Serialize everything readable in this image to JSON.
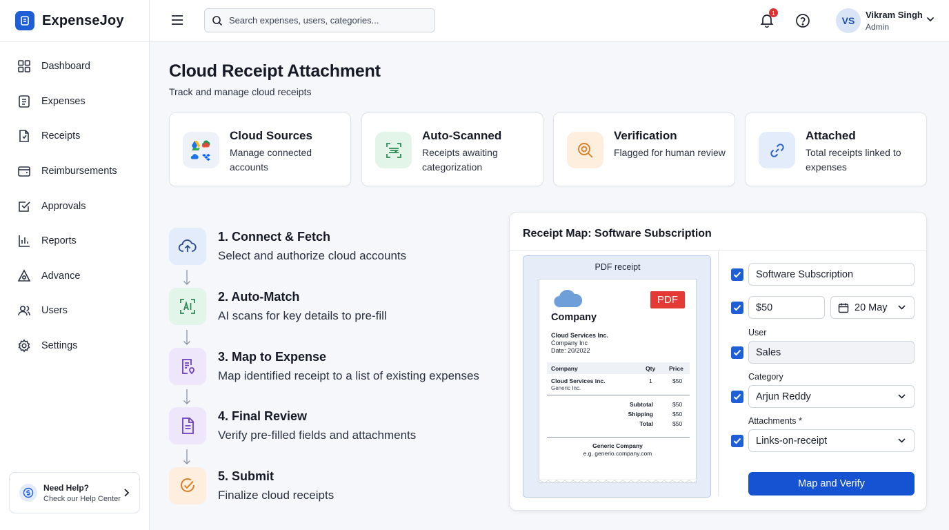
{
  "app": {
    "name": "ExpenseJoy"
  },
  "sidebar": {
    "items": [
      {
        "label": "Dashboard",
        "icon": "grid-icon"
      },
      {
        "label": "Expenses",
        "icon": "list-icon"
      },
      {
        "label": "Receipts",
        "icon": "receipt-icon"
      },
      {
        "label": "Reimbursements",
        "icon": "wallet-icon"
      },
      {
        "label": "Approvals",
        "icon": "check-square-icon"
      },
      {
        "label": "Reports",
        "icon": "bar-chart-icon"
      },
      {
        "label": "Advance",
        "icon": "triangle-icon"
      },
      {
        "label": "Users",
        "icon": "users-icon"
      },
      {
        "label": "Settings",
        "icon": "gear-icon"
      }
    ],
    "help": {
      "title": "Need Help?",
      "subtitle": "Check our Help Center"
    }
  },
  "topbar": {
    "search_placeholder": "Search expenses, users, categories...",
    "notifications_count": "1",
    "user": {
      "initials": "VS",
      "name": "Vikram Singh",
      "role": "Admin"
    }
  },
  "page": {
    "title": "Cloud Receipt Attachment",
    "subtitle": "Track and manage cloud receipts"
  },
  "cards": [
    {
      "title": "Cloud Sources",
      "desc": "Manage connected accounts",
      "icon": "cloud-apps-icon",
      "bg": "#eef2f8"
    },
    {
      "title": "Auto-Scanned",
      "desc": "Receipts awaiting categorization",
      "icon": "scan-icon",
      "bg": "#e3f4e8"
    },
    {
      "title": "Verification",
      "desc": "Flagged for human review",
      "icon": "magnify-icon",
      "bg": "#fdeedd"
    },
    {
      "title": "Attached",
      "desc": "Total receipts linked to expenses",
      "icon": "link-icon",
      "bg": "#e3ecfb"
    }
  ],
  "steps": [
    {
      "title": "1. Connect & Fetch",
      "desc": "Select and authorize cloud accounts",
      "icon": "cloud-upload-icon",
      "bg": "#e3ecfb"
    },
    {
      "title": "2. Auto-Match",
      "desc": "AI scans for key details to pre-fill",
      "icon": "ai-icon",
      "bg": "#e3f4e8"
    },
    {
      "title": "3. Map to Expense",
      "desc": "Map identified receipt to a list of existing expenses",
      "icon": "map-doc-icon",
      "bg": "#eee6fa"
    },
    {
      "title": "4. Final Review",
      "desc": "Verify pre-filled fields and attachments",
      "icon": "document-icon",
      "bg": "#eee6fa"
    },
    {
      "title": "5. Submit",
      "desc": "Finalize cloud receipts",
      "icon": "check-circle-icon",
      "bg": "#fdeedd"
    }
  ],
  "map_panel": {
    "title": "Receipt Map: Software Subscription",
    "receipt": {
      "label": "PDF receipt",
      "badge": "PDF",
      "company": "Company",
      "vendor": "Cloud Services Inc.",
      "vendor_sub": "Company Inc",
      "date": "Date: 20/2022",
      "columns": [
        "Company",
        "Qty",
        "Price"
      ],
      "row": {
        "name": "Cloud Services inc.",
        "sub": "Generic Inc.",
        "qty": "1",
        "price": "$50"
      },
      "subtotal_label": "Subtotal",
      "subtotal": "$50",
      "shipping_label": "Shipping",
      "shipping": "$50",
      "total_label": "Total",
      "total": "$50",
      "footer_company": "Generic Company",
      "footer_url": "e.g. generio.company.com"
    },
    "form": {
      "title_value": "Software Subscription",
      "amount_value": "$50",
      "date_value": "20 May",
      "user_label": "User",
      "user_value": "Sales",
      "category_label": "Category",
      "category_value": "Arjun Reddy",
      "attachments_label": "Attachments *",
      "attachments_value": "Links-on-receipt",
      "submit_label": "Map and Verify"
    }
  },
  "colors": {
    "primary": "#1553d3",
    "badge": "#e03131",
    "pdf": "#e53935"
  }
}
